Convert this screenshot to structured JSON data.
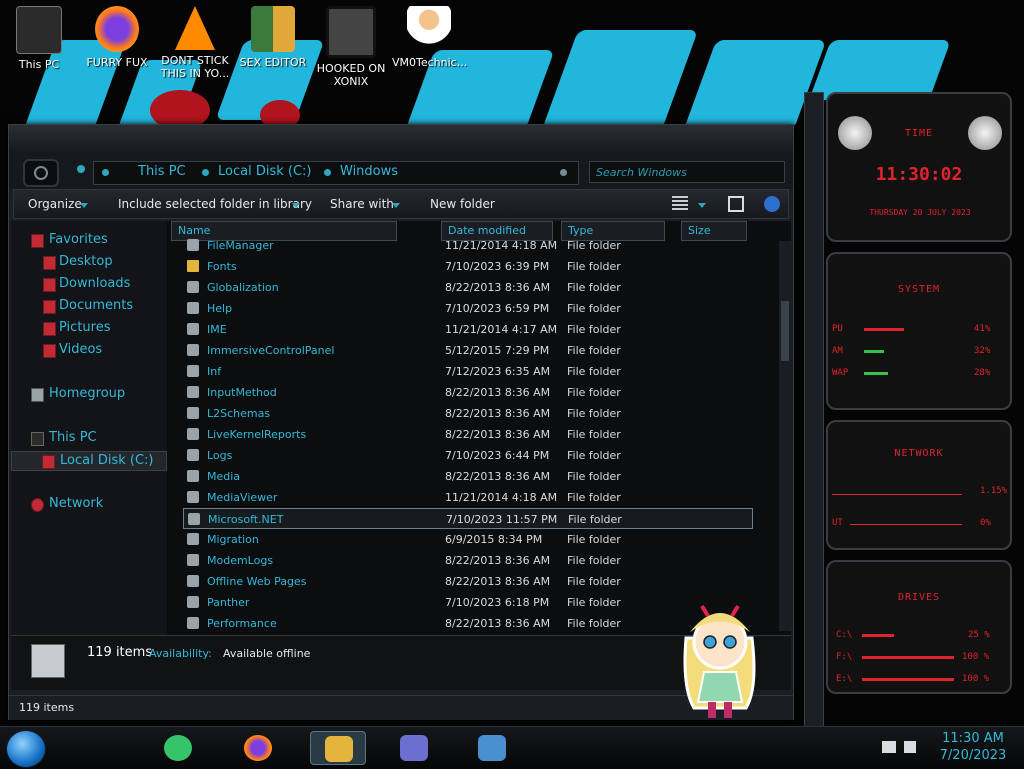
{
  "desktop": {
    "icons": [
      {
        "label": "This PC"
      },
      {
        "label": "FURRY FUX"
      },
      {
        "label": "DONT STICK THIS IN YO..."
      },
      {
        "label": "SEX EDITOR"
      },
      {
        "label": "HOOKED ON XONIX"
      },
      {
        "label": "VM0Technic..."
      }
    ]
  },
  "explorer": {
    "address": {
      "segments": [
        "This PC",
        "Local Disk (C:)",
        "Windows"
      ]
    },
    "search": {
      "placeholder": "Search Windows"
    },
    "toolbar": {
      "organize": "Organize",
      "include": "Include selected folder in library",
      "share": "Share with",
      "new_folder": "New folder"
    },
    "nav": {
      "favorites": "Favorites",
      "desktop": "Desktop",
      "downloads": "Downloads",
      "documents": "Documents",
      "pictures": "Pictures",
      "videos": "Videos",
      "homegroup": "Homegroup",
      "this_pc": "This PC",
      "local_disk": "Local Disk (C:)",
      "network": "Network"
    },
    "columns": {
      "name": "Name",
      "date": "Date modified",
      "type": "Type",
      "size": "Size"
    },
    "files": [
      {
        "name": "FileManager",
        "date": "11/21/2014 4:18 AM",
        "type": "File folder"
      },
      {
        "name": "Fonts",
        "date": "7/10/2023 6:39 PM",
        "type": "File folder"
      },
      {
        "name": "Globalization",
        "date": "8/22/2013 8:36 AM",
        "type": "File folder"
      },
      {
        "name": "Help",
        "date": "7/10/2023 6:59 PM",
        "type": "File folder"
      },
      {
        "name": "IME",
        "date": "11/21/2014 4:17 AM",
        "type": "File folder"
      },
      {
        "name": "ImmersiveControlPanel",
        "date": "5/12/2015 7:29 PM",
        "type": "File folder"
      },
      {
        "name": "Inf",
        "date": "7/12/2023 6:35 AM",
        "type": "File folder"
      },
      {
        "name": "InputMethod",
        "date": "8/22/2013 8:36 AM",
        "type": "File folder"
      },
      {
        "name": "L2Schemas",
        "date": "8/22/2013 8:36 AM",
        "type": "File folder"
      },
      {
        "name": "LiveKernelReports",
        "date": "8/22/2013 8:36 AM",
        "type": "File folder"
      },
      {
        "name": "Logs",
        "date": "7/10/2023 6:44 PM",
        "type": "File folder"
      },
      {
        "name": "Media",
        "date": "8/22/2013 8:36 AM",
        "type": "File folder"
      },
      {
        "name": "MediaViewer",
        "date": "11/21/2014 4:18 AM",
        "type": "File folder"
      },
      {
        "name": "Microsoft.NET",
        "date": "7/10/2023 11:57 PM",
        "type": "File folder"
      },
      {
        "name": "Migration",
        "date": "6/9/2015 8:34 PM",
        "type": "File folder"
      },
      {
        "name": "ModemLogs",
        "date": "8/22/2013 8:36 AM",
        "type": "File folder"
      },
      {
        "name": "Offline Web Pages",
        "date": "8/22/2013 8:36 AM",
        "type": "File folder"
      },
      {
        "name": "Panther",
        "date": "7/10/2023 6:18 PM",
        "type": "File folder"
      },
      {
        "name": "Performance",
        "date": "8/22/2013 8:36 AM",
        "type": "File folder"
      }
    ],
    "details": {
      "count": "119 items",
      "availability_label": "Availability:",
      "availability_value": "Available offline"
    },
    "status": "119 items"
  },
  "gadgets": {
    "time_title": "TIME",
    "time_value": "11:30:02",
    "date_value": "THURSDAY 20 JULY 2023",
    "system_title": "SYSTEM",
    "cpu_label": "PU",
    "cpu_value": "41%",
    "ram_label": "AM",
    "ram_value": "32%",
    "swap_label": "WAP",
    "swap_value": "28%",
    "network_title": "NETWORK",
    "net_in_value": "1.15%",
    "net_out_label": "UT",
    "net_out_value": "0%",
    "drives_title": "DRIVES",
    "drive_c_label": "C:\\",
    "drive_c_value": "25 %",
    "drive_f_label": "F:\\",
    "drive_f_value": "100 %",
    "drive_e_label": "E:\\",
    "drive_e_value": "100 %"
  },
  "taskbar": {
    "clock_time": "11:30 AM",
    "clock_date": "7/20/2023"
  },
  "colors": {
    "accent": "#34b9d8",
    "gadget_red": "#e0242c"
  }
}
